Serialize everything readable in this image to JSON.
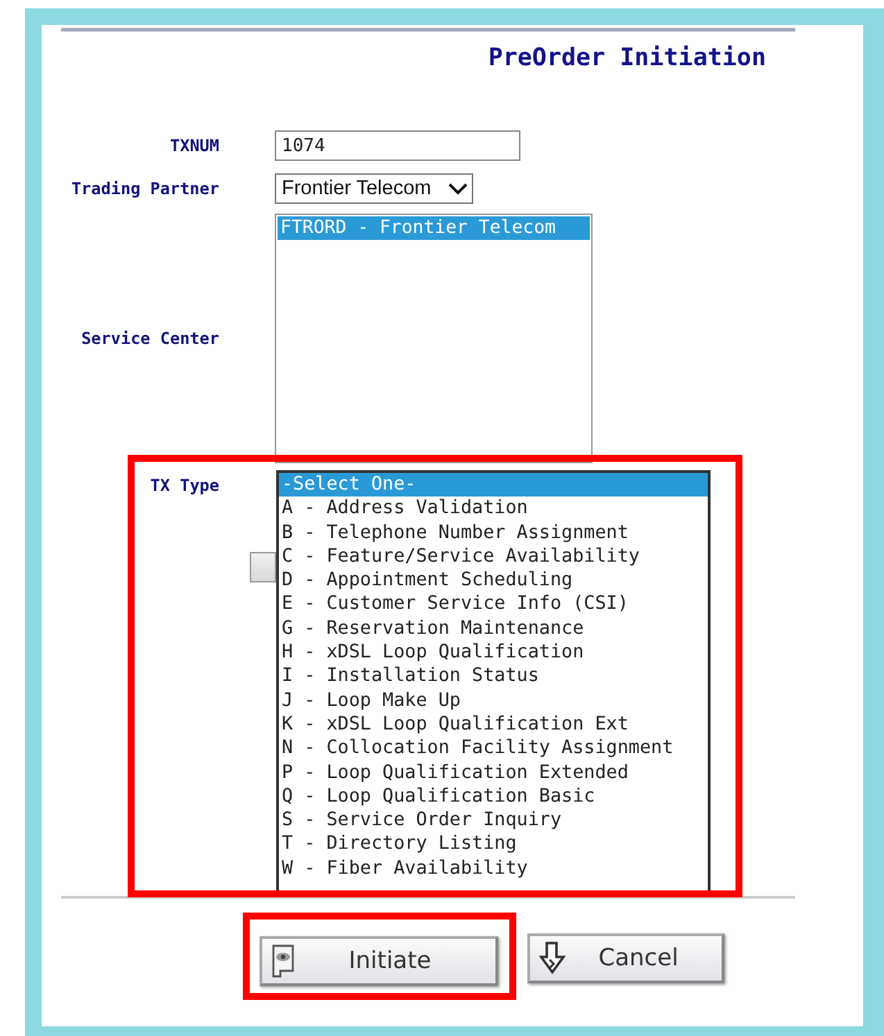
{
  "title": "PreOrder Initiation",
  "txnum": {
    "label": "TXNUM",
    "value": "1074"
  },
  "trading_partner": {
    "label": "Trading Partner",
    "value": "Frontier Telecom"
  },
  "service_center": {
    "label": "Service Center",
    "options": [
      {
        "text": "FTRORD - Frontier Telecom",
        "selected": true
      }
    ]
  },
  "tx_type": {
    "label": "TX Type",
    "highlighted": true,
    "options": [
      {
        "text": "-Select One-",
        "selected": true
      },
      {
        "text": "A - Address Validation",
        "selected": false
      },
      {
        "text": "B - Telephone Number Assignment",
        "selected": false
      },
      {
        "text": "C - Feature/Service Availability",
        "selected": false
      },
      {
        "text": "D - Appointment Scheduling",
        "selected": false
      },
      {
        "text": "E - Customer Service Info (CSI)",
        "selected": false
      },
      {
        "text": "G - Reservation Maintenance",
        "selected": false
      },
      {
        "text": "H - xDSL Loop Qualification",
        "selected": false
      },
      {
        "text": "I - Installation Status",
        "selected": false
      },
      {
        "text": "J - Loop Make Up",
        "selected": false
      },
      {
        "text": "K - xDSL Loop Qualification Ext",
        "selected": false
      },
      {
        "text": "N - Collocation Facility Assignment",
        "selected": false
      },
      {
        "text": "P - Loop Qualification Extended",
        "selected": false
      },
      {
        "text": "Q - Loop Qualification Basic",
        "selected": false
      },
      {
        "text": "S - Service Order Inquiry",
        "selected": false
      },
      {
        "text": "T - Directory Listing",
        "selected": false
      },
      {
        "text": "W - Fiber Availability",
        "selected": false
      }
    ]
  },
  "buttons": [
    {
      "label": "Initiate",
      "kind": "initiate",
      "highlighted": true
    },
    {
      "label": "Cancel",
      "kind": "cancel",
      "highlighted": false
    }
  ]
}
